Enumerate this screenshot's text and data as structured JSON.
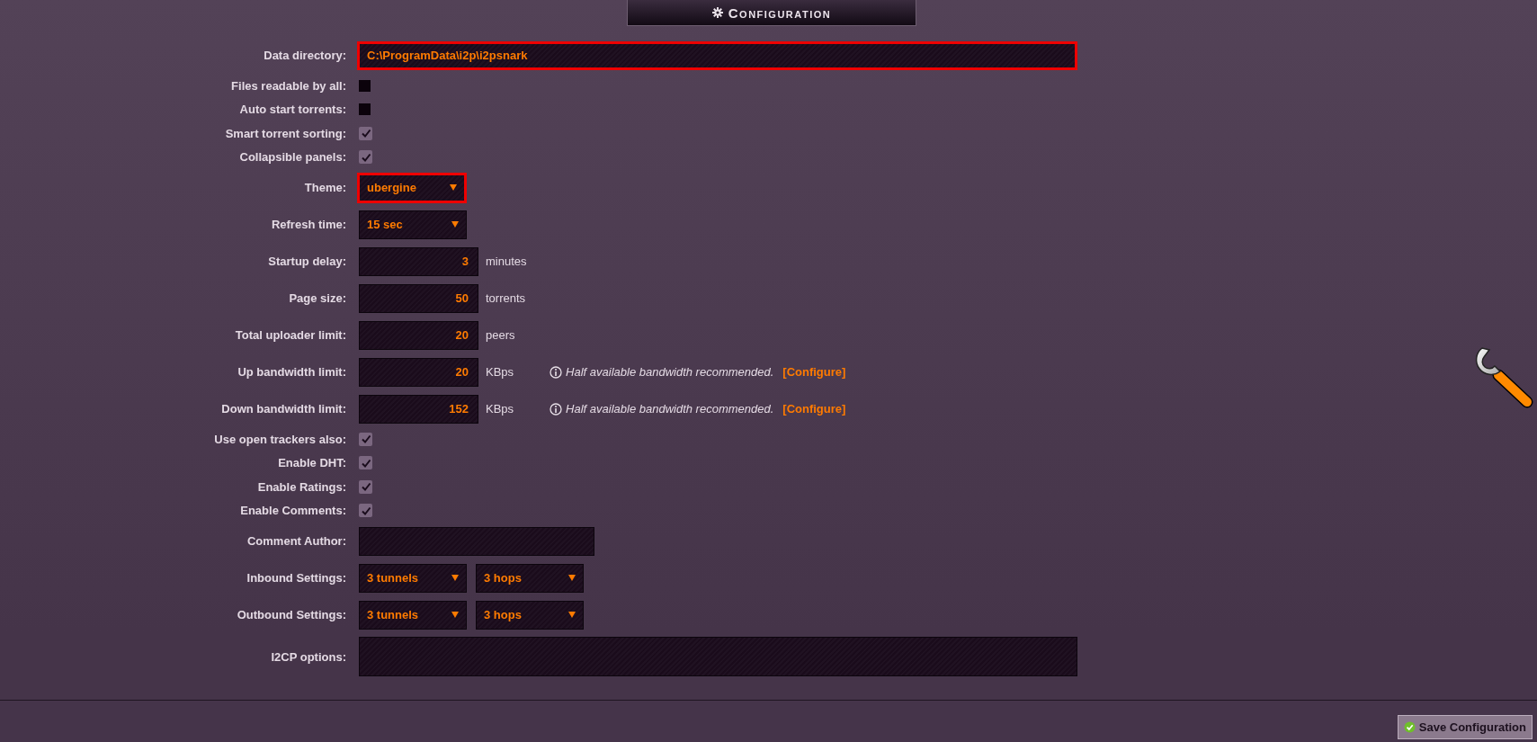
{
  "header": {
    "title": "Configuration"
  },
  "settings": [
    {
      "kind": "path",
      "label": "Data directory:",
      "value": "C:\\ProgramData\\i2p\\i2psnark",
      "highlighted": true
    },
    {
      "kind": "checkbox",
      "label": "Files readable by all:",
      "checked": false
    },
    {
      "kind": "checkbox",
      "label": "Auto start torrents:",
      "checked": false
    },
    {
      "kind": "checkbox",
      "label": "Smart torrent sorting:",
      "checked": true
    },
    {
      "kind": "checkbox",
      "label": "Collapsible panels:",
      "checked": true
    },
    {
      "kind": "select",
      "label": "Theme:",
      "value": "ubergine",
      "highlighted": true
    },
    {
      "kind": "select",
      "label": "Refresh time:",
      "value": "15 sec",
      "highlighted": false
    },
    {
      "kind": "number",
      "label": "Startup delay:",
      "value": "3",
      "unit": "minutes"
    },
    {
      "kind": "number",
      "label": "Page size:",
      "value": "50",
      "unit": "torrents"
    },
    {
      "kind": "number",
      "label": "Total uploader limit:",
      "value": "20",
      "unit": "peers"
    },
    {
      "kind": "number",
      "label": "Up bandwidth limit:",
      "value": "20",
      "unit": "KBps",
      "note": "Half available bandwidth recommended.",
      "link": "[Configure]"
    },
    {
      "kind": "number",
      "label": "Down bandwidth limit:",
      "value": "152",
      "unit": "KBps",
      "note": "Half available bandwidth recommended.",
      "link": "[Configure]"
    },
    {
      "kind": "checkbox",
      "label": "Use open trackers also:",
      "checked": true
    },
    {
      "kind": "checkbox",
      "label": "Enable DHT:",
      "checked": true
    },
    {
      "kind": "checkbox",
      "label": "Enable Ratings:",
      "checked": true
    },
    {
      "kind": "checkbox",
      "label": "Enable Comments:",
      "checked": true
    },
    {
      "kind": "text",
      "label": "Comment Author:",
      "highlighted": false
    },
    {
      "kind": "select_pair",
      "label": "Inbound Settings:",
      "values": [
        "3 tunnels",
        "3 hops"
      ]
    },
    {
      "kind": "select_pair",
      "label": "Outbound Settings:",
      "values": [
        "3 tunnels",
        "3 hops"
      ]
    },
    {
      "kind": "textarea",
      "label": "I2CP options:"
    }
  ],
  "save_button": "Save Configuration"
}
